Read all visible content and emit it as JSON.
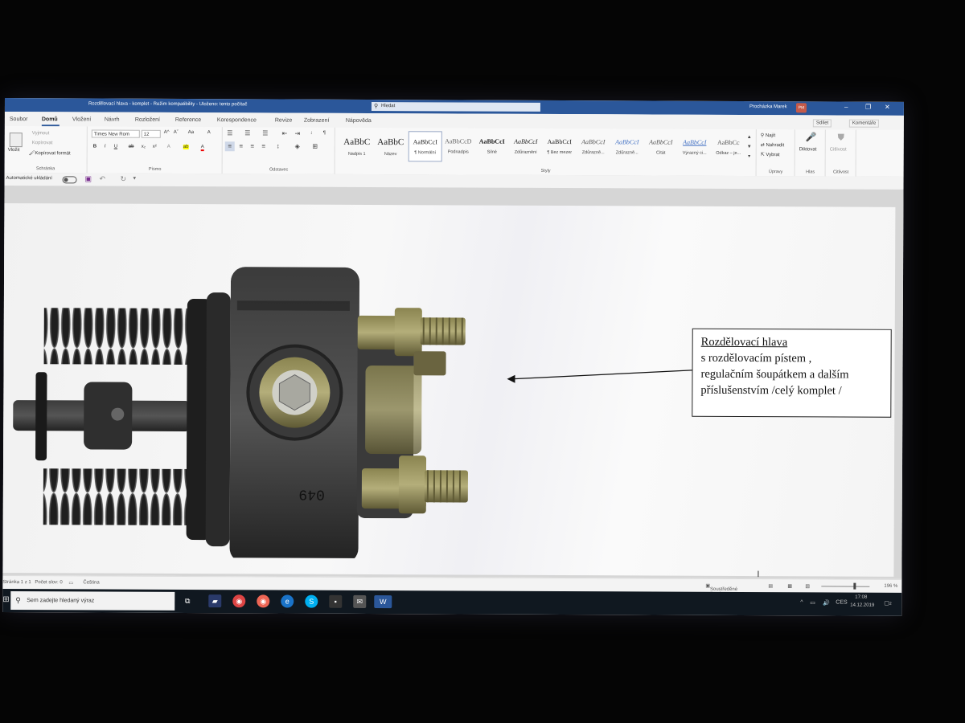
{
  "titlebar": {
    "doc_title": "Rozdělovací hlava - komplet  -  Režim kompatibility  -  Uloženo: tento počítač",
    "search_placeholder": "Hledat",
    "user_name": "Procházka Marek",
    "user_initials": "PM",
    "minimize": "–",
    "restore": "❐",
    "close": "✕"
  },
  "menus": [
    "Soubor",
    "Domů",
    "Vložení",
    "Návrh",
    "Rozložení",
    "Reference",
    "Korespondence",
    "Revize",
    "Zobrazení",
    "Nápověda"
  ],
  "share_label": "Sdílet",
  "comments_label": "Komentáře",
  "ribbon": {
    "clipboard": {
      "paste": "Vložit",
      "cut": "Vyjmout",
      "copy": "Kopírovat",
      "format_painter": "Kopírovat formát",
      "label": "Schránka"
    },
    "font": {
      "font_name": "Times New Rom",
      "font_size": "12",
      "label": "Písmo",
      "bold": "B",
      "italic": "I",
      "underline": "U",
      "strike": "ab",
      "subscript": "x₂",
      "superscript": "x²",
      "grow": "A^",
      "shrink": "Aˇ",
      "case": "Aa",
      "clear": "A",
      "highlight": "ab",
      "color": "A"
    },
    "paragraph": {
      "label": "Odstavec",
      "sort": "↓",
      "pilcrow": "¶"
    },
    "styles": {
      "label": "Styly",
      "items": [
        {
          "sample": "AaBbC",
          "name": "Nadpis 1"
        },
        {
          "sample": "AaBbC",
          "name": "Název"
        },
        {
          "sample": "AaBbCcI",
          "name": "¶ Normální"
        },
        {
          "sample": "AaBbCcD",
          "name": "Podnadpis"
        },
        {
          "sample": "AaBbCcI",
          "name": "Silné"
        },
        {
          "sample": "AaBbCcI",
          "name": "Zdůraznění"
        },
        {
          "sample": "AaBbCcI",
          "name": "¶ Bez mezer"
        },
        {
          "sample": "AaBbCcI",
          "name": "Zdůrazně..."
        },
        {
          "sample": "AaBbCcI",
          "name": "Zdůrazně..."
        },
        {
          "sample": "AaBbCcI",
          "name": "Citát"
        },
        {
          "sample": "AaBbCcI",
          "name": "Výrazný ci..."
        },
        {
          "sample": "AaBbCc",
          "name": "Odkaz – je..."
        }
      ]
    },
    "editing": {
      "find": "Najít",
      "replace": "Nahradit",
      "select": "Vybrat",
      "label": "Úpravy"
    },
    "voice": {
      "dictate": "Diktovat",
      "label": "Hlas"
    },
    "sensitivity": {
      "btn": "Citlivost",
      "label": "Citlivost"
    }
  },
  "qat": {
    "autosave": "Automatické ukládání"
  },
  "document": {
    "callout_heading": "Rozdělovací  hlava",
    "callout_lines": [
      "s rozdělovacím pístem ,",
      "regulačním šoupátkem a dalším",
      "příslušenstvím /celý komplet /"
    ],
    "stamp_number": "049"
  },
  "status": {
    "page": "Stránka 1 z 1",
    "words": "Počet slov: 0",
    "language": "Čeština",
    "focus": "Soustředěné čtení",
    "zoom": "196 %"
  },
  "taskbar": {
    "search_placeholder": "Sem zadejte hledaný výraz",
    "language": "CES",
    "time": "17:08",
    "date": "14.12.2019",
    "notifications": "2"
  },
  "colors": {
    "word_blue": "#2b579a",
    "taskbar": "#101820"
  }
}
